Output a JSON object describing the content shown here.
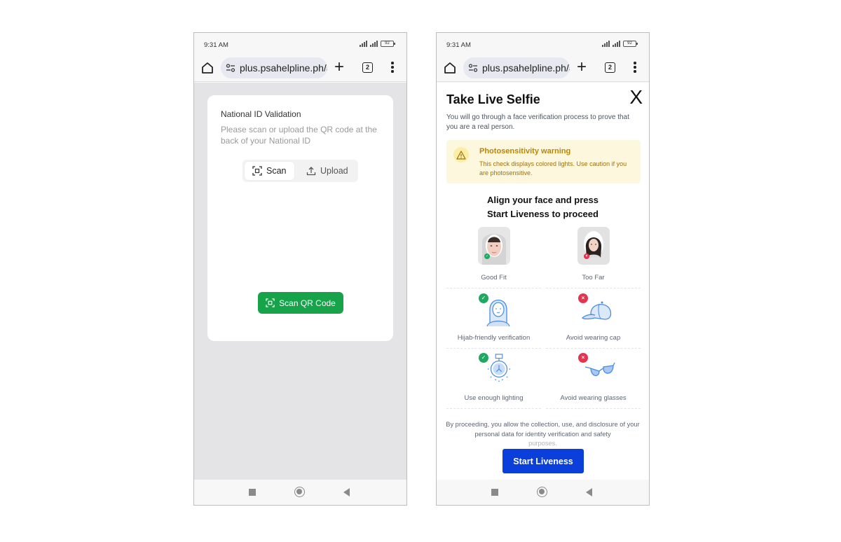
{
  "screens": [
    {
      "status_bar": {
        "time": "9:31 AM",
        "battery": "92"
      },
      "browser": {
        "url": "plus.psahelpline.ph/au",
        "tab_count": "2"
      },
      "card": {
        "title": "National ID Validation",
        "description": "Please scan or upload the QR code at the back of your National ID",
        "tabs": [
          {
            "label": "Scan",
            "icon": "qr-scan-icon",
            "selected": true
          },
          {
            "label": "Upload",
            "icon": "upload-icon",
            "selected": false
          }
        ],
        "scan_button": "Scan QR Code"
      },
      "colors": {
        "primary_button": "#16a34a",
        "background": "#e4e4e6"
      }
    },
    {
      "status_bar": {
        "time": "9:31 AM",
        "battery": "92"
      },
      "browser": {
        "url": "plus.psahelpline.ph/au",
        "tab_count": "2"
      },
      "modal": {
        "title": "Take Live Selfie",
        "close_label": "X",
        "description": "You will go through a face verification process to prove that you are a real person.",
        "warning": {
          "title": "Photosensitivity warning",
          "text": "This check displays colored lights. Use caution if you are photosensitive."
        },
        "instruction_line1": "Align your face and press",
        "instruction_line2": "Start Liveness to proceed",
        "tips": [
          {
            "label": "Good Fit",
            "status": "ok",
            "icon": "good-fit-photo"
          },
          {
            "label": "Too Far",
            "status": "no",
            "icon": "too-far-photo"
          },
          {
            "label": "Hijab-friendly verification",
            "status": "ok",
            "icon": "hijab-icon"
          },
          {
            "label": "Avoid wearing cap",
            "status": "no",
            "icon": "cap-icon"
          },
          {
            "label": "Use enough lighting",
            "status": "ok",
            "icon": "lightbulb-icon"
          },
          {
            "label": "Avoid wearing glasses",
            "status": "no",
            "icon": "glasses-icon"
          }
        ],
        "consent_main": "By proceeding, you allow the collection, use, and disclosure of your personal data for identity verification and safety",
        "consent_tail": "purposes.",
        "start_button": "Start Liveness"
      },
      "colors": {
        "primary_button": "#0a3fdb",
        "ok": "#1ea862",
        "no": "#e5344f",
        "warning_bg": "#fdf7dd"
      }
    }
  ]
}
